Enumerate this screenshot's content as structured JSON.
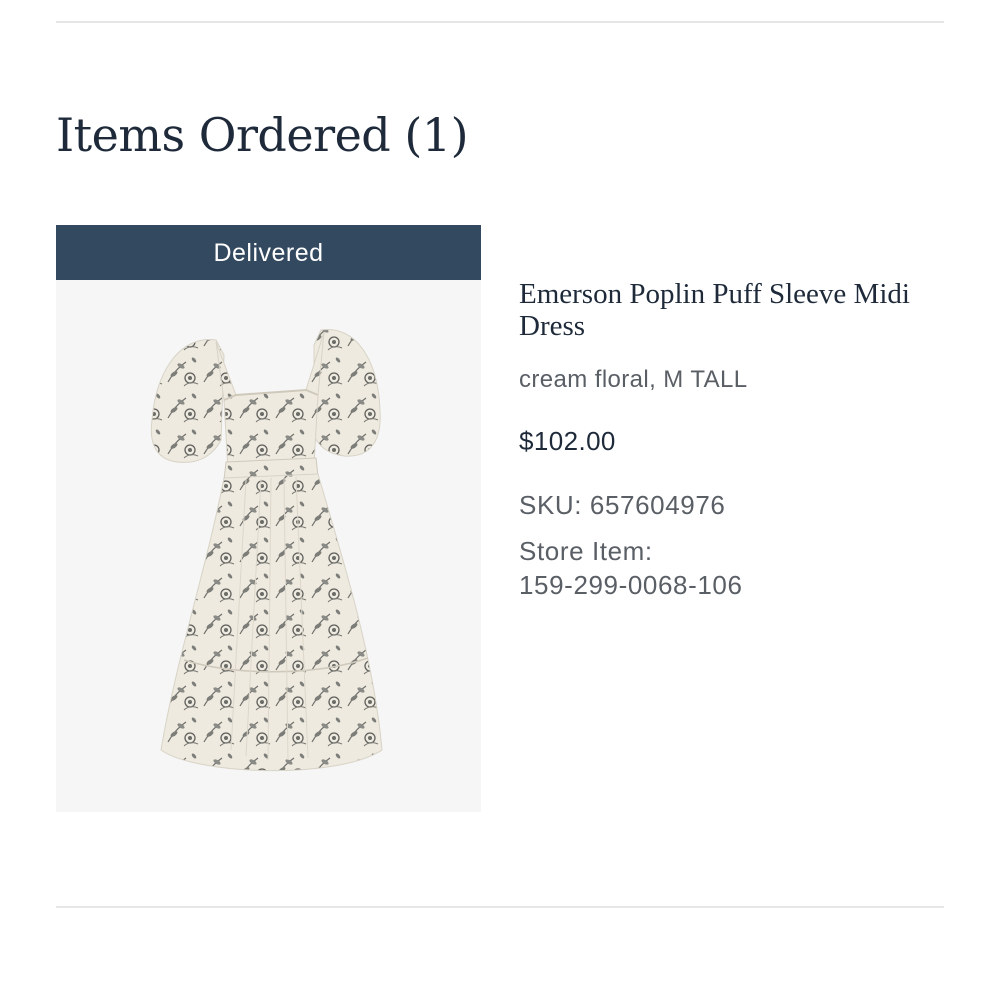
{
  "section": {
    "title": "Items Ordered (1)"
  },
  "item": {
    "status": "Delivered",
    "image_icon": "dress-photo",
    "name": "Emerson Poplin Puff Sleeve Midi Dress",
    "variant": "cream floral, M TALL",
    "price": "$102.00",
    "sku": "SKU: 657604976",
    "store_item_label": "Store Item:",
    "store_item_number": "159-299-0068-106"
  },
  "colors": {
    "banner": "#33495f",
    "heading": "#1e2a3a",
    "muted_text": "#5a5f66",
    "divider": "#e6e6e6"
  }
}
